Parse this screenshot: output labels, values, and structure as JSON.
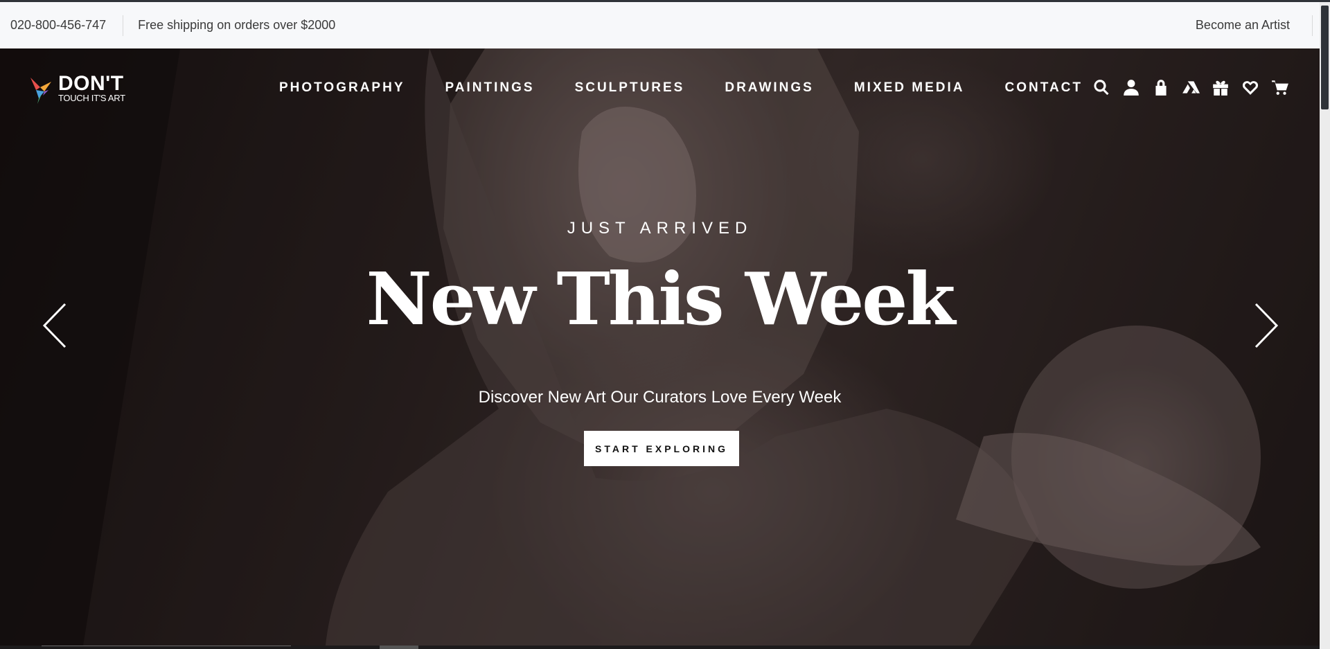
{
  "topbar": {
    "phone": "020-800-456-747",
    "shipping": "Free shipping on orders over $2000",
    "become_artist": "Become an Artist"
  },
  "logo": {
    "brand": "DON'T",
    "tagline": "TOUCH IT'S ART"
  },
  "nav": {
    "items": [
      "PHOTOGRAPHY",
      "PAINTINGS",
      "SCULPTURES",
      "DRAWINGS",
      "MIXED MEDIA",
      "CONTACT"
    ]
  },
  "header_icons": [
    "search-icon",
    "account-icon",
    "lock-icon",
    "artsy-icon",
    "gift-icon",
    "heart-icon",
    "cart-icon"
  ],
  "hero": {
    "eyebrow": "JUST ARRIVED",
    "headline": "New This Week",
    "subline": "Discover New Art Our Curators Love Every Week",
    "cta": "START EXPLORING"
  },
  "colors": {
    "topbar_bg": "#f7f8fa",
    "hero_text": "#ffffff",
    "cta_bg": "#ffffff",
    "cta_text": "#111111"
  }
}
